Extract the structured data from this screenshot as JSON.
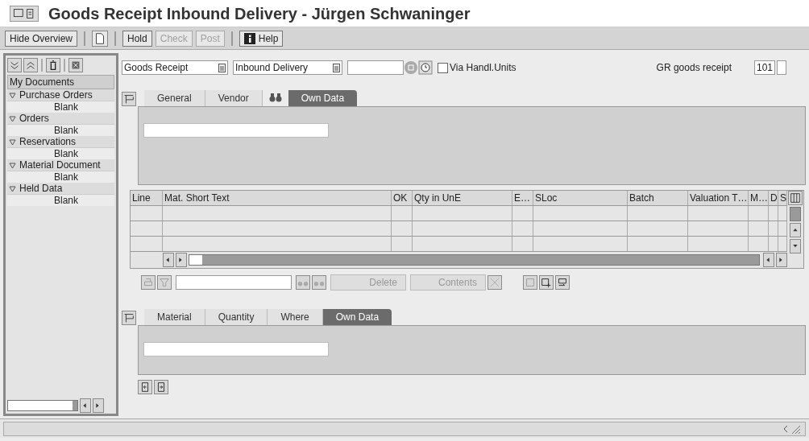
{
  "window": {
    "title": "Goods Receipt Inbound Delivery - Jürgen Schwaninger"
  },
  "toolbar": [
    {
      "kind": "text",
      "label": "Hide Overview",
      "disabled": false
    },
    {
      "kind": "icon",
      "disabled": false
    },
    {
      "kind": "text",
      "label": "Hold",
      "disabled": false
    },
    {
      "kind": "text",
      "label": "Check",
      "disabled": true
    },
    {
      "kind": "text",
      "label": "Post",
      "disabled": true
    },
    {
      "kind": "help",
      "label": "Help",
      "disabled": false
    }
  ],
  "sidebar": {
    "title": "My Documents",
    "items": [
      {
        "label": "Purchase Orders",
        "expanded": true,
        "children": [
          {
            "label": "Blank"
          }
        ]
      },
      {
        "label": "Orders",
        "expanded": true,
        "children": [
          {
            "label": "Blank"
          }
        ]
      },
      {
        "label": "Reservations",
        "expanded": true,
        "children": [
          {
            "label": "Blank"
          }
        ]
      },
      {
        "label": "Material Document",
        "expanded": true,
        "children": [
          {
            "label": "Blank"
          }
        ]
      },
      {
        "label": "Held Data",
        "expanded": true,
        "children": [
          {
            "label": "Blank"
          }
        ]
      }
    ]
  },
  "header": {
    "action": "Goods Receipt",
    "reference": "Inbound Delivery",
    "via_handling_units": {
      "label": "Via Handl.Units",
      "checked": false
    },
    "movement_label": "GR goods receipt",
    "movement_type": "101"
  },
  "header_tabs": [
    {
      "label": "General",
      "selected": false
    },
    {
      "label": "Vendor",
      "selected": false
    },
    {
      "label": "Own Data",
      "selected": true
    }
  ],
  "table": {
    "columns": [
      "Line",
      "Mat. Short Text",
      "OK",
      "Qty in UnE",
      "E…",
      "SLoc",
      "Batch",
      "Valuation T…",
      "M…",
      "D",
      "S"
    ]
  },
  "table_toolbar": [
    {
      "label": "Delete",
      "disabled": true
    },
    {
      "label": "Contents",
      "disabled": true
    }
  ],
  "item_tabs": [
    {
      "label": "Material",
      "selected": false
    },
    {
      "label": "Quantity",
      "selected": false
    },
    {
      "label": "Where",
      "selected": false
    },
    {
      "label": "Own Data",
      "selected": true
    }
  ]
}
